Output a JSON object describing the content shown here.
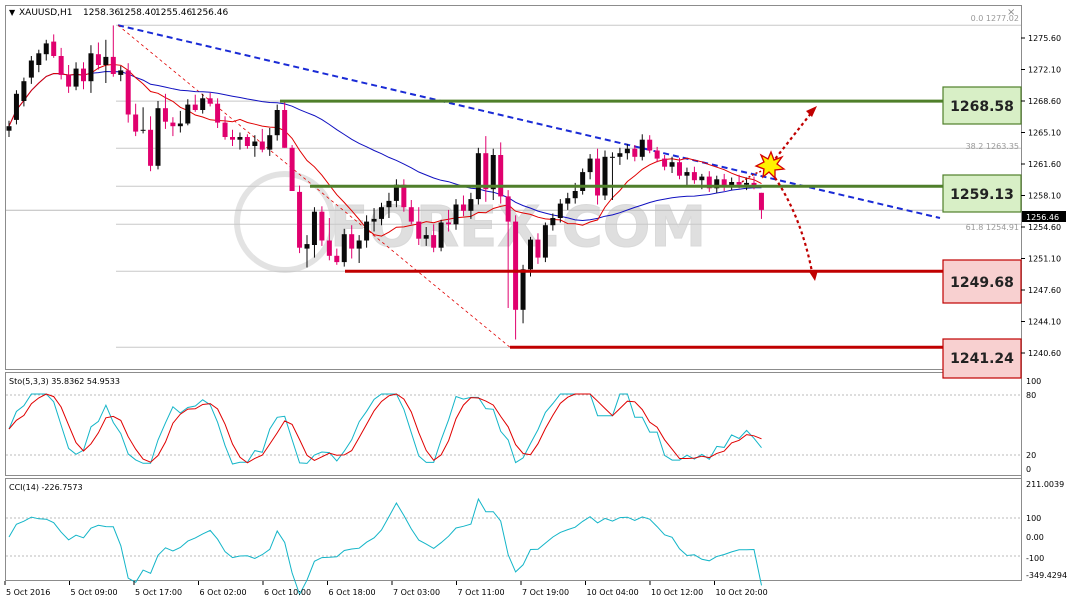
{
  "header": {
    "symbol": "XAUUSD,H1",
    "open": "1258.36",
    "high": "1258.40",
    "low": "1255.46",
    "close": "1256.46"
  },
  "watermark": "FOREX.COM",
  "price_axis": {
    "ticks": [
      "1275.60",
      "1272.10",
      "1268.60",
      "1265.10",
      "1261.60",
      "1258.10",
      "1254.60",
      "1251.10",
      "1247.60",
      "1244.10",
      "1240.60"
    ],
    "current_price": "1256.46"
  },
  "fib_labels": [
    "0.0 1277.02",
    "38.2 1263.35",
    "61.8 1254.91"
  ],
  "levels": [
    {
      "label": "1268.58",
      "value": 1268.58,
      "role": "resistance",
      "color": "#4f7f2a",
      "box_fill": "#d8efc6"
    },
    {
      "label": "1259.13",
      "value": 1259.13,
      "role": "pivot",
      "color": "#4f7f2a",
      "box_fill": "#d8efc6"
    },
    {
      "label": "1249.68",
      "value": 1249.68,
      "role": "support",
      "color": "#c00000",
      "box_fill": "#f8d0d0"
    },
    {
      "label": "1241.24",
      "value": 1241.24,
      "role": "support",
      "color": "#c00000",
      "box_fill": "#f8d0d0"
    }
  ],
  "stochastic": {
    "label": "Sto(5,3,3) 35.8362 54.9533",
    "ticks": [
      "100",
      "80",
      "20",
      "0"
    ]
  },
  "cci": {
    "label": "CCI(14) -226.7573",
    "ticks": [
      "211.0039",
      "100",
      "0.00",
      "-100",
      "-349.4294"
    ]
  },
  "time_axis": [
    "5 Oct 2016",
    "5 Oct 09:00",
    "5 Oct 17:00",
    "6 Oct 02:00",
    "6 Oct 10:00",
    "6 Oct 18:00",
    "7 Oct 03:00",
    "7 Oct 11:00",
    "7 Oct 19:00",
    "10 Oct 04:00",
    "10 Oct 12:00",
    "10 Oct 20:00"
  ],
  "colors": {
    "bull_candle": "#0a0a0a",
    "bear_candle": "#e0006e",
    "ma_fast": "#e00000",
    "ma_slow": "#1010c0",
    "trendline": "#1a2bd6",
    "fib_line": "#e00000",
    "stoch_main": "#13b5c8",
    "stoch_signal": "#e00000",
    "cci_line": "#13b5c8"
  },
  "chart_data": {
    "type": "candlestick",
    "symbol": "XAUUSD",
    "timeframe": "H1",
    "ylim": [
      1239.6,
      1279.1
    ],
    "ohlc": [
      [
        1265.3,
        1266.4,
        1264.6,
        1265.8
      ],
      [
        1266.5,
        1269.8,
        1266,
        1269.4
      ],
      [
        1268.6,
        1271.2,
        1268,
        1270.8
      ],
      [
        1271.2,
        1273.6,
        1270.5,
        1273.1
      ],
      [
        1272.6,
        1274.3,
        1271.8,
        1273.9
      ],
      [
        1273.8,
        1275.4,
        1273.1,
        1275
      ],
      [
        1275.2,
        1276,
        1273.4,
        1273.6
      ],
      [
        1273.6,
        1274.5,
        1271,
        1271.5
      ],
      [
        1271.5,
        1272.6,
        1269.5,
        1270.2
      ],
      [
        1270.2,
        1272.9,
        1269.8,
        1272.2
      ],
      [
        1272.2,
        1272.9,
        1269.9,
        1270.8
      ],
      [
        1270.8,
        1274.8,
        1269.5,
        1273.9
      ],
      [
        1273.8,
        1275.1,
        1272.1,
        1272.6
      ],
      [
        1272.6,
        1275.4,
        1270.6,
        1273.5
      ],
      [
        1273.5,
        1277,
        1271.3,
        1271.6
      ],
      [
        1271.5,
        1272.5,
        1270.8,
        1272
      ],
      [
        1272,
        1272.8,
        1266.2,
        1267.1
      ],
      [
        1267.1,
        1268.3,
        1264.7,
        1265.2
      ],
      [
        1265.3,
        1267.9,
        1265,
        1265.4
      ],
      [
        1265.4,
        1266.9,
        1260.8,
        1261.4
      ],
      [
        1261.4,
        1268.6,
        1261,
        1267.8
      ],
      [
        1267.8,
        1269.4,
        1265.5,
        1266.3
      ],
      [
        1266.2,
        1266.8,
        1264.7,
        1265.8
      ],
      [
        1265.8,
        1267.5,
        1265.1,
        1266.1
      ],
      [
        1266.1,
        1268.8,
        1265.9,
        1268.2
      ],
      [
        1268.2,
        1269.3,
        1267.4,
        1267.6
      ],
      [
        1267.6,
        1269.4,
        1267.2,
        1268.9
      ],
      [
        1268.9,
        1269.5,
        1268,
        1268.3
      ],
      [
        1268.3,
        1268.9,
        1265.6,
        1266.2
      ],
      [
        1266.2,
        1266.9,
        1264.3,
        1264.6
      ],
      [
        1264.6,
        1265.4,
        1263.6,
        1264.3
      ],
      [
        1264.3,
        1265.1,
        1263.2,
        1264.6
      ],
      [
        1264.6,
        1264.9,
        1263.3,
        1263.6
      ],
      [
        1263.6,
        1264.8,
        1262.4,
        1264.1
      ],
      [
        1264.1,
        1265.5,
        1262.9,
        1263.2
      ],
      [
        1263.2,
        1265.6,
        1262.5,
        1264.8
      ],
      [
        1264.8,
        1268.2,
        1264.2,
        1267.6
      ],
      [
        1267.6,
        1268.5,
        1263.4,
        1263.4
      ],
      [
        1263.4,
        1263.7,
        1258.6,
        1258.6
      ],
      [
        1258.5,
        1259.2,
        1251.7,
        1252.3
      ],
      [
        1252.2,
        1253.7,
        1250.1,
        1252.7
      ],
      [
        1252.6,
        1256.8,
        1251.2,
        1256.3
      ],
      [
        1256.3,
        1256.9,
        1252.5,
        1253.1
      ],
      [
        1253.1,
        1255.6,
        1250.9,
        1251.4
      ],
      [
        1251.4,
        1252.2,
        1250.4,
        1250.7
      ],
      [
        1250.7,
        1254.4,
        1250.2,
        1253.8
      ],
      [
        1253.8,
        1254.8,
        1251.1,
        1252.2
      ],
      [
        1252.2,
        1253.7,
        1250.6,
        1253.1
      ],
      [
        1253.1,
        1255.9,
        1252.3,
        1255.2
      ],
      [
        1255.2,
        1256.7,
        1254.1,
        1255.5
      ],
      [
        1255.5,
        1257.3,
        1254.8,
        1256.8
      ],
      [
        1256.8,
        1258.4,
        1255.6,
        1257.5
      ],
      [
        1257.5,
        1259.9,
        1256.8,
        1259.3
      ],
      [
        1259.3,
        1259.9,
        1256.3,
        1256.8
      ],
      [
        1256.8,
        1257.6,
        1254.9,
        1255.2
      ],
      [
        1255.2,
        1256.8,
        1252.6,
        1253.3
      ],
      [
        1253.3,
        1254.6,
        1252.5,
        1253.7
      ],
      [
        1253.7,
        1254.9,
        1251.8,
        1252.3
      ],
      [
        1252.3,
        1255.4,
        1251.9,
        1255.1
      ],
      [
        1255.1,
        1256.5,
        1254.1,
        1254.9
      ],
      [
        1254.9,
        1257.7,
        1254.3,
        1257.1
      ],
      [
        1257.1,
        1258.1,
        1255.8,
        1256.4
      ],
      [
        1256.4,
        1258.4,
        1255.5,
        1257.7
      ],
      [
        1257.7,
        1263.4,
        1257.1,
        1262.8
      ],
      [
        1262.8,
        1264.7,
        1257.4,
        1258.8
      ],
      [
        1258.8,
        1263.3,
        1257.6,
        1262.6
      ],
      [
        1262.6,
        1264,
        1257.2,
        1258
      ],
      [
        1258,
        1258.7,
        1245.6,
        1255.2
      ],
      [
        1255.2,
        1255.9,
        1242.1,
        1245.4
      ],
      [
        1245.4,
        1250.4,
        1243.9,
        1249.9
      ],
      [
        1249.9,
        1253.5,
        1249.1,
        1253.2
      ],
      [
        1253.2,
        1253.9,
        1250.5,
        1251.2
      ],
      [
        1251.2,
        1255.1,
        1250.7,
        1254.8
      ],
      [
        1254.8,
        1256.1,
        1254.2,
        1255.6
      ],
      [
        1255.6,
        1257.7,
        1255.1,
        1257.2
      ],
      [
        1257.2,
        1258.4,
        1256.5,
        1257.8
      ],
      [
        1257.8,
        1259.5,
        1257.2,
        1258.6
      ],
      [
        1258.6,
        1261.1,
        1258.2,
        1260.7
      ],
      [
        1260.7,
        1262.7,
        1259.9,
        1262.2
      ],
      [
        1262.2,
        1263.3,
        1257.1,
        1258.1
      ],
      [
        1258.1,
        1263.1,
        1257.6,
        1262.4
      ],
      [
        1262.4,
        1262.9,
        1257.6,
        1262.4
      ],
      [
        1262.4,
        1263.4,
        1261.5,
        1262.8
      ],
      [
        1262.8,
        1263.8,
        1262.1,
        1263.3
      ],
      [
        1263.3,
        1263.7,
        1261.9,
        1262.4
      ],
      [
        1262.4,
        1264.9,
        1262,
        1264.3
      ],
      [
        1264.3,
        1264.8,
        1262.8,
        1263.1
      ],
      [
        1263.1,
        1263.5,
        1261.8,
        1262.2
      ],
      [
        1262.2,
        1262.6,
        1260.9,
        1261.3
      ],
      [
        1261.3,
        1262.4,
        1260.6,
        1261.8
      ],
      [
        1261.8,
        1262.3,
        1259.9,
        1260.3
      ],
      [
        1260.3,
        1261.2,
        1259.1,
        1260.7
      ],
      [
        1260.7,
        1261.3,
        1259.4,
        1259.8
      ],
      [
        1259.8,
        1260.5,
        1258.8,
        1260.2
      ],
      [
        1260.2,
        1260.8,
        1258.5,
        1258.9
      ],
      [
        1258.9,
        1260.3,
        1258.4,
        1259.9
      ],
      [
        1259.9,
        1260.5,
        1258.6,
        1259.1
      ],
      [
        1259.1,
        1260.1,
        1258.7,
        1259.6
      ],
      [
        1259.6,
        1260.4,
        1258.9,
        1259.3
      ],
      [
        1259.3,
        1260.1,
        1258.7,
        1259.5
      ],
      [
        1259.5,
        1260.2,
        1258.8,
        1259.2
      ],
      [
        1258.4,
        1258.4,
        1255.5,
        1256.5
      ]
    ]
  }
}
